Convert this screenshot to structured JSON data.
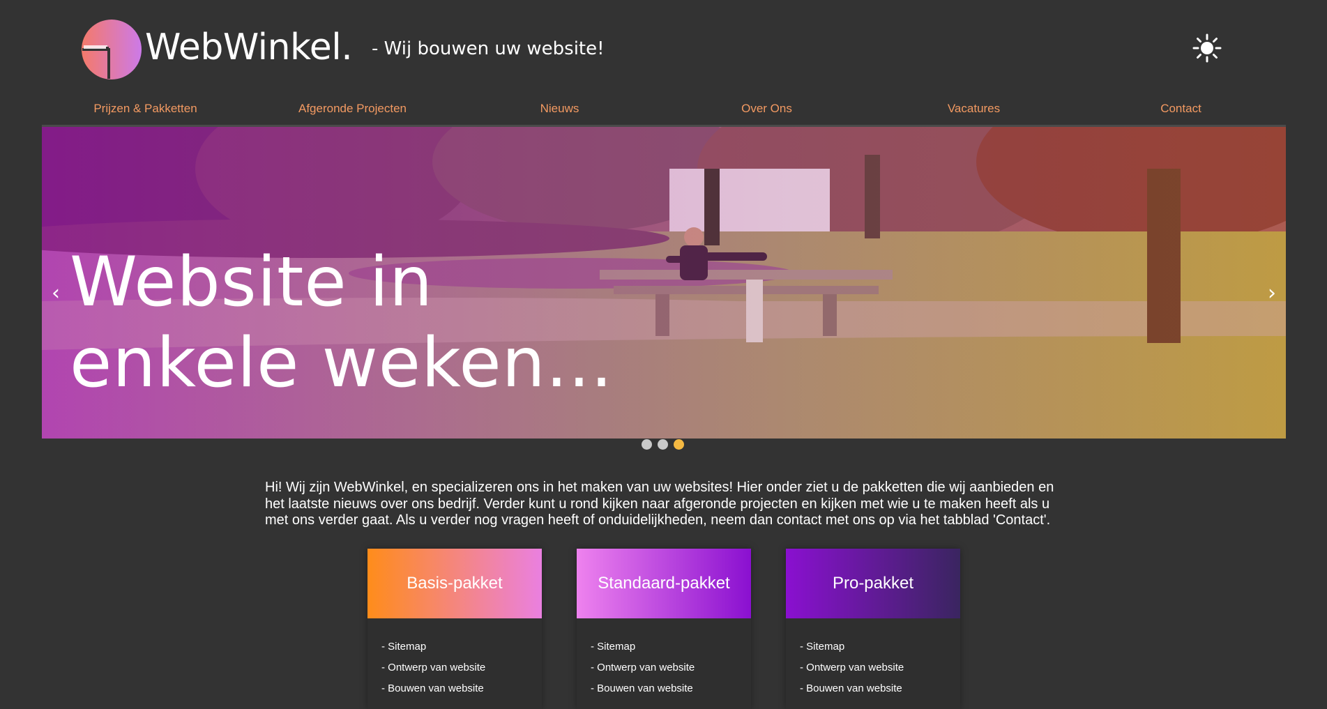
{
  "header": {
    "logo_text": "WebWinkel.",
    "tagline": "- Wij bouwen uw website!",
    "theme_toggle_icon": "sun-icon"
  },
  "nav": {
    "items": [
      {
        "label": "Prijzen & Pakketten"
      },
      {
        "label": "Afgeronde Projecten"
      },
      {
        "label": "Nieuws"
      },
      {
        "label": "Over Ons"
      },
      {
        "label": "Vacatures"
      },
      {
        "label": "Contact"
      }
    ],
    "color": "#f39a62"
  },
  "hero": {
    "title_line1": "Website in",
    "title_line2": "enkele weken...",
    "prev_label": "‹",
    "next_label": "›",
    "slide_count": 3,
    "active_slide": 3
  },
  "intro": {
    "text": "Hi! Wij zijn WebWinkel, en specializeren ons in het maken van uw websites! Hier onder ziet u de pakketten die wij aanbieden en het laatste nieuws over ons bedrijf. Verder kunt u rond kijken naar afgeronde projecten en kijken met wie u te maken heeft als u met ons verder gaat. Als u verder nog vragen heeft of onduidelijkheden, neem dan contact met ons op via het tabblad 'Contact'."
  },
  "packages": [
    {
      "title": "Basis-pakket",
      "gradient": [
        "#ff8c1a",
        "#ea80e0"
      ],
      "features": [
        "- Sitemap",
        "- Ontwerp van website",
        "- Bouwen van website"
      ]
    },
    {
      "title": "Standaard-pakket",
      "gradient": [
        "#ee82ee",
        "#8a10d0"
      ],
      "features": [
        "- Sitemap",
        "- Ontwerp van website",
        "- Bouwen van website"
      ]
    },
    {
      "title": "Pro-pakket",
      "gradient": [
        "#8a10d0",
        "#3a2560"
      ],
      "features": [
        "- Sitemap",
        "- Ontwerp van website",
        "- Bouwen van website"
      ]
    }
  ]
}
